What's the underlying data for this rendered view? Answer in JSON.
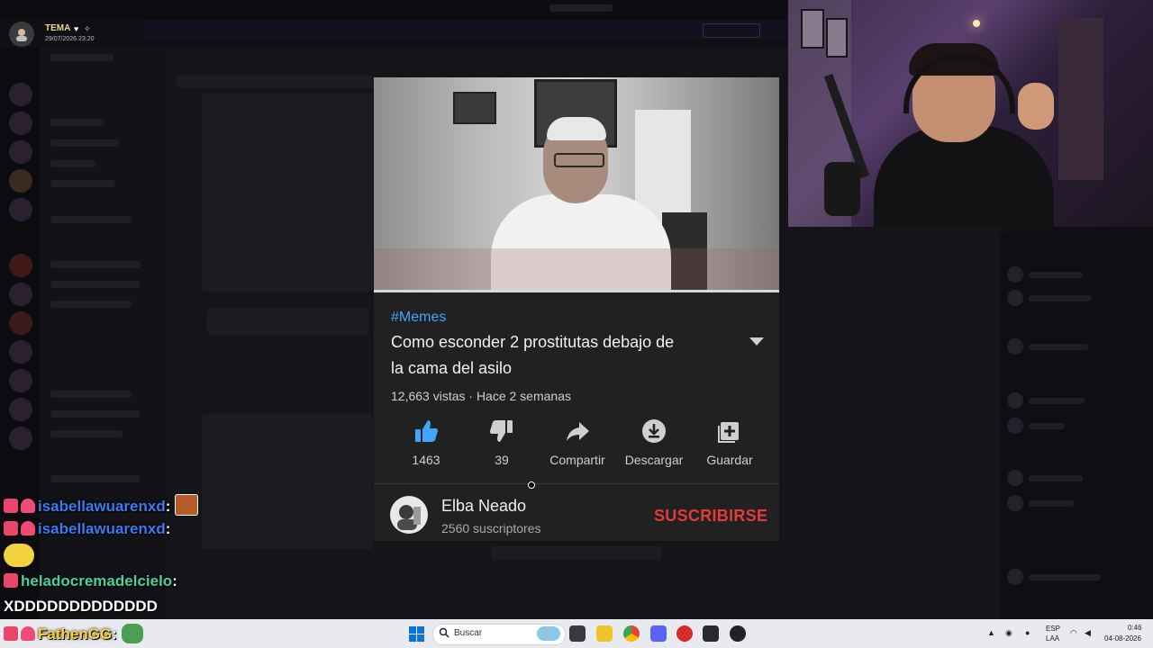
{
  "notification": {
    "title": "TEMA",
    "timestamp": "29/07/2026 23:20"
  },
  "video": {
    "hashtag": "#Memes",
    "title_line1": "Como esconder 2 prostitutas debajo de",
    "title_line2": "la cama del asilo",
    "meta": "12,663 vistas · Hace 2 semanas",
    "actions": [
      {
        "icon": "thumbs-up-icon",
        "label": "1463"
      },
      {
        "icon": "thumbs-down-icon",
        "label": "39"
      },
      {
        "icon": "share-icon",
        "label": "Compartir"
      },
      {
        "icon": "download-icon",
        "label": "Descargar"
      },
      {
        "icon": "save-playlist-icon",
        "label": "Guardar"
      }
    ],
    "channel": {
      "name": "Elba Neado",
      "subscribers": "2560 suscriptores",
      "subscribe_label": "SUSCRIBIRSE"
    }
  },
  "chat": [
    {
      "user": "isabellawuarenxd",
      "suffix": ":",
      "message": ""
    },
    {
      "user": "isabellawuarenxd",
      "suffix": ":",
      "message": ""
    },
    {
      "user": "heladocremadelcielo",
      "suffix": ":",
      "message": "XDDDDDDDDDDDDD"
    },
    {
      "user": "FathenGG",
      "suffix": ":",
      "message": ""
    }
  ],
  "taskbar": {
    "search_placeholder": "Buscar",
    "lang_line1": "ESP",
    "lang_line2": "LAA",
    "time": "0:46",
    "date": "04-08-2026"
  },
  "colors": {
    "accent_link": "#3ea6ff",
    "subscribe": "#e23b3b",
    "chat_blue": "#3a7bf0",
    "chat_green": "#45d39b"
  }
}
